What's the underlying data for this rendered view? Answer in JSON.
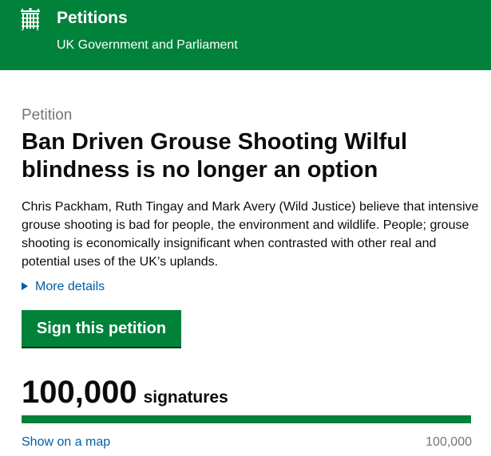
{
  "header": {
    "title": "Petitions",
    "subtitle": "UK Government and Parliament",
    "logo_icon": "portcullis-icon",
    "background_color": "#00823b"
  },
  "petition": {
    "label": "Petition",
    "title": "Ban Driven Grouse Shooting Wilful blindness is no longer an option",
    "summary": "Chris Packham, Ruth Tingay and Mark Avery (Wild Justice) believe that intensive grouse shooting is bad for people, the environment and wildlife. People; grouse shooting is economically insignificant when contrasted with other real and potential uses of the UK’s uplands.",
    "more_details_label": "More details",
    "sign_button_label": "Sign this petition"
  },
  "signatures": {
    "count": "100,000",
    "unit_label": "signatures",
    "target": "100,000",
    "progress_fraction": 1.0,
    "map_link_label": "Show on a map",
    "progress_color": "#00823b"
  }
}
